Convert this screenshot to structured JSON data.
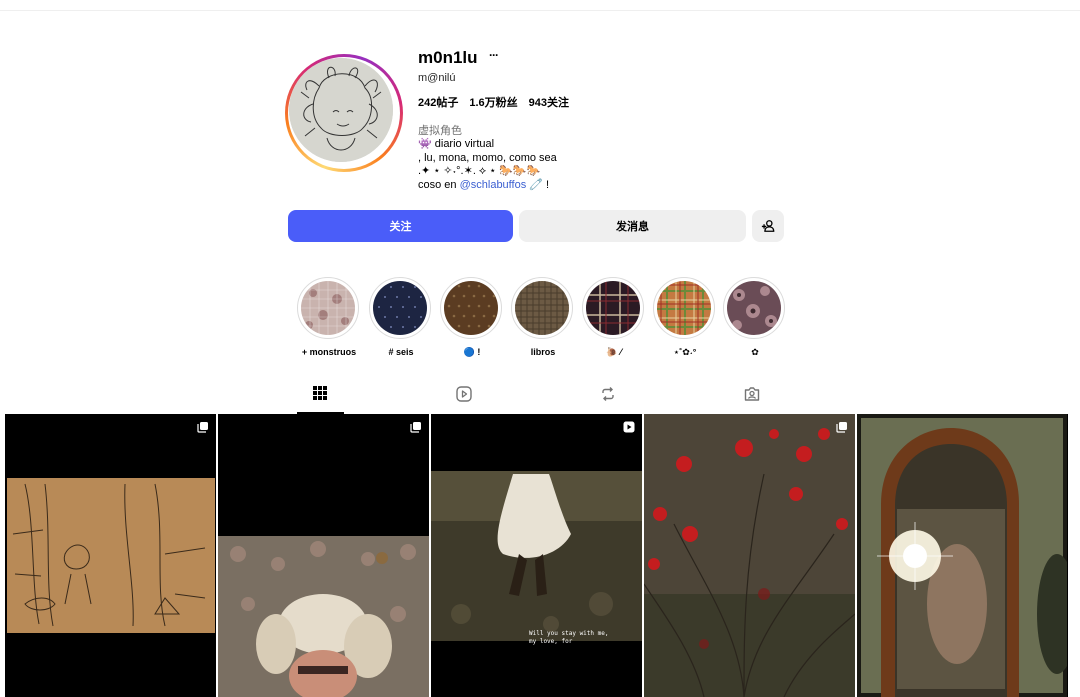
{
  "profile": {
    "username": "m0n1lu",
    "more": "···",
    "full_name": "m@nilú",
    "stats": {
      "posts": "242帖子",
      "followers": "1.6万粉丝",
      "following": "943关注"
    },
    "category": "虚拟角色",
    "bio": {
      "line1": "👾 diario virtual",
      "line2": ", lu, mona, momo, como sea",
      "line3": ".✦ ⋆ ✧˖°.✶. ⟡ ⋆ 🐎🐎🐎",
      "line4_prefix": "coso en ",
      "line4_mention": "@schlabuffos",
      "line4_suffix": " 🧷 !"
    }
  },
  "actions": {
    "follow_label": "关注",
    "message_label": "发消息",
    "add_icon": "person-plus-icon"
  },
  "highlights": [
    {
      "label": "+ monstruos",
      "color": "#bfa7a5"
    },
    {
      "label": "# seis",
      "color": "#1c2440"
    },
    {
      "label": "🔵 !",
      "color": "#5a3b22"
    },
    {
      "label": "libros",
      "color": "#6d5840"
    },
    {
      "label": "🐌 ⁄",
      "color": "#2c1a22"
    },
    {
      "label": "⋆˚✿˖°",
      "color": "#b86a3c"
    },
    {
      "label": "✿",
      "color": "#6b4e55"
    }
  ],
  "tabs": [
    {
      "name": "posts",
      "icon": "grid-icon",
      "active": true
    },
    {
      "name": "reels",
      "icon": "reels-icon",
      "active": false
    },
    {
      "name": "reposts",
      "icon": "repost-icon",
      "active": false
    },
    {
      "name": "tagged",
      "icon": "tagged-icon",
      "active": false
    }
  ],
  "posts": [
    {
      "type": "carousel",
      "description_icon": "multiple-icon"
    },
    {
      "type": "carousel",
      "description_icon": "multiple-icon"
    },
    {
      "type": "video",
      "description_icon": "reel-icon",
      "caption": "Will you stay with me, my love, for"
    },
    {
      "type": "carousel",
      "description_icon": "multiple-icon"
    },
    {
      "type": "image"
    }
  ]
}
